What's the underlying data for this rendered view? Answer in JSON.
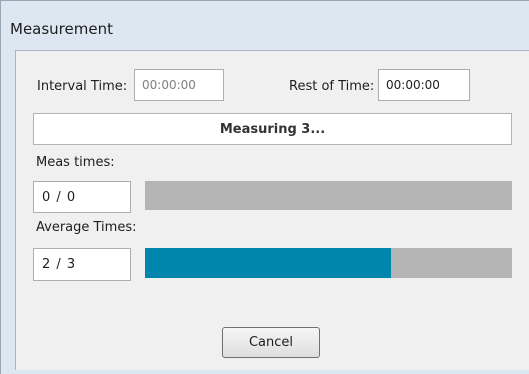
{
  "window": {
    "title": "Measurement"
  },
  "interval": {
    "label": "Interval Time:",
    "value": "00:00:00"
  },
  "rest": {
    "label": "Rest of Time:",
    "value": "00:00:00"
  },
  "status": {
    "text": "Measuring 3..."
  },
  "meas_times": {
    "label": "Meas times:",
    "value": "0 / 0",
    "progress_fraction": 0.0
  },
  "average_times": {
    "label": "Average Times:",
    "value": "2 / 3",
    "progress_fraction": 0.67
  },
  "buttons": {
    "cancel": "Cancel"
  },
  "colors": {
    "progress_fill": "#0085ad",
    "progress_track": "#b4b4b4"
  }
}
